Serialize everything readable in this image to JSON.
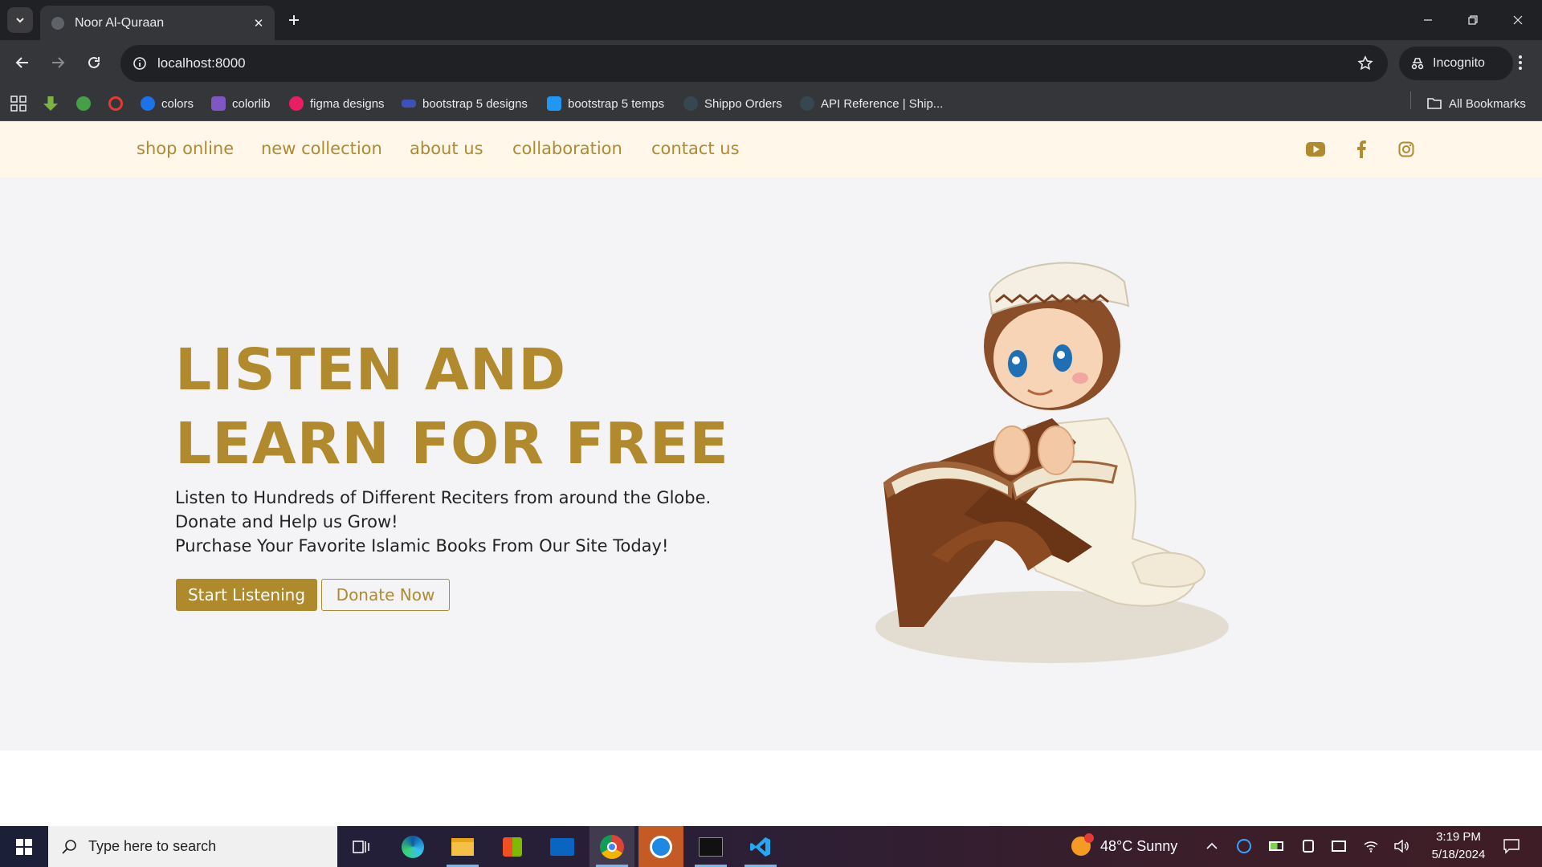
{
  "browser": {
    "tab_title": "Noor Al-Quraan",
    "url": "localhost:8000",
    "incognito_label": "Incognito",
    "bookmarks": [
      {
        "label": "colors",
        "color": "#1a73e8"
      },
      {
        "label": "colorlib",
        "color": "#7e57c2"
      },
      {
        "label": "figma designs",
        "color": "#e91e63"
      },
      {
        "label": "bootstrap 5 designs",
        "color": "#3f51b5"
      },
      {
        "label": "bootstrap 5 temps",
        "color": "#2196f3"
      },
      {
        "label": "Shippo Orders",
        "color": "#37474f"
      },
      {
        "label": "API Reference | Ship...",
        "color": "#37474f"
      }
    ],
    "all_bookmarks_label": "All Bookmarks"
  },
  "site": {
    "nav": {
      "links": [
        "shop online",
        "new collection",
        "about us",
        "collaboration",
        "contact us"
      ],
      "social": [
        "youtube-icon",
        "facebook-icon",
        "instagram-icon"
      ]
    },
    "hero": {
      "title_line1": "LISTEN AND",
      "title_line2": "LEARN FOR FREE",
      "lines": [
        "Listen to Hundreds of Different Reciters from around the Globe.",
        "Donate and Help us Grow!",
        "Purchase Your Favorite Islamic Books From Our Site Today!"
      ],
      "primary_button": "Start Listening",
      "secondary_button": "Donate Now"
    },
    "colors": {
      "accent": "#b08a2e",
      "nav_bg": "#fff7e9",
      "hero_bg": "#f4f4f6"
    }
  },
  "taskbar": {
    "search_placeholder": "Type here to search",
    "weather": "48°C  Sunny",
    "time": "3:19 PM",
    "date": "5/18/2024"
  }
}
